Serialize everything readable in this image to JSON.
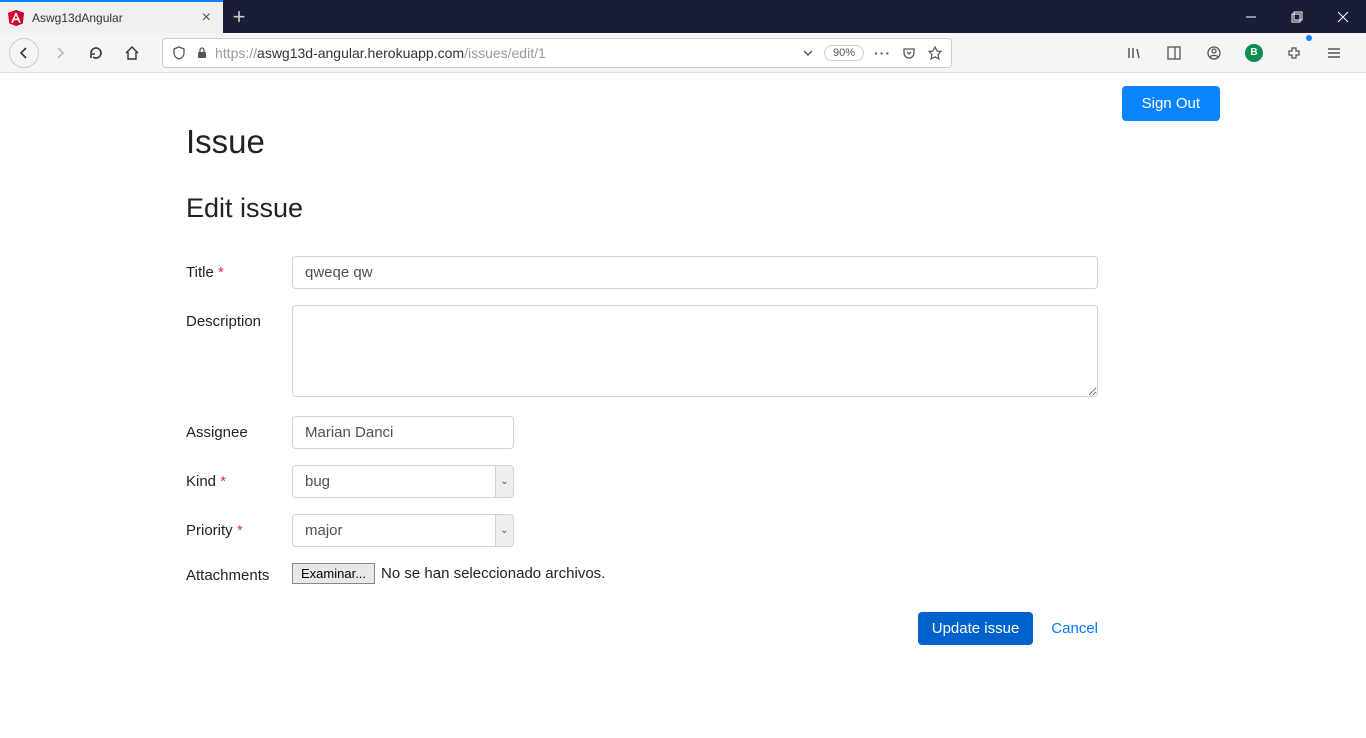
{
  "browser": {
    "tab_title": "Aswg13dAngular",
    "url_prefix": "https://",
    "url_domain": "aswg13d-angular.herokuapp.com",
    "url_path": "/issues/edit/1",
    "zoom": "90%"
  },
  "header": {
    "sign_out": "Sign Out"
  },
  "page": {
    "title": "Issue",
    "subtitle": "Edit issue"
  },
  "form": {
    "title": {
      "label": "Title",
      "value": "qweqe qw"
    },
    "description": {
      "label": "Description",
      "value": ""
    },
    "assignee": {
      "label": "Assignee",
      "value": "Marian Danci"
    },
    "kind": {
      "label": "Kind",
      "value": "bug"
    },
    "priority": {
      "label": "Priority",
      "value": "major"
    },
    "attachments": {
      "label": "Attachments",
      "button": "Examinar...",
      "status": "No se han seleccionado archivos."
    }
  },
  "actions": {
    "submit": "Update issue",
    "cancel": "Cancel"
  }
}
